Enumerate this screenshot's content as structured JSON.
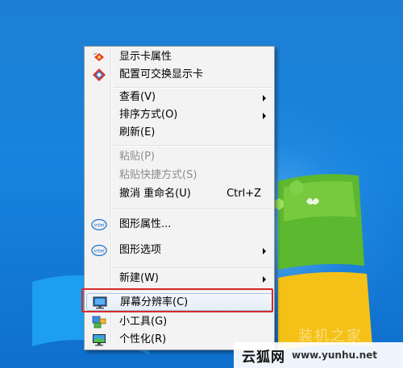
{
  "menu": {
    "items": [
      {
        "label": "显示卡属性",
        "icon": "display-card-icon"
      },
      {
        "label": "配置可交换显示卡",
        "icon": "switchable-graphics-icon"
      },
      {
        "label": "查看(V)",
        "submenu": true
      },
      {
        "label": "排序方式(O)",
        "submenu": true
      },
      {
        "label": "刷新(E)"
      },
      {
        "label": "粘贴(P)",
        "disabled": true
      },
      {
        "label": "粘贴快捷方式(S)",
        "disabled": true
      },
      {
        "label": "撤消 重命名(U)",
        "shortcut": "Ctrl+Z"
      },
      {
        "label": "图形属性...",
        "icon": "intel-icon",
        "icon_text": "intel"
      },
      {
        "label": "图形选项",
        "icon": "intel-icon",
        "icon_text": "intel",
        "submenu": true
      },
      {
        "label": "新建(W)",
        "submenu": true
      },
      {
        "label": "屏幕分辨率(C)",
        "icon": "monitor-icon",
        "highlighted": true
      },
      {
        "label": "小工具(G)",
        "icon": "gadgets-icon"
      },
      {
        "label": "个性化(R)",
        "icon": "personalize-icon"
      }
    ]
  },
  "watermark": {
    "brand": "云狐网",
    "url": "www.yunhu.net",
    "faint_text": "装机之家"
  },
  "colors": {
    "desktop_blue": "#1684de",
    "highlight_red": "#d62a2a",
    "menu_bg": "#f3f3f3"
  }
}
